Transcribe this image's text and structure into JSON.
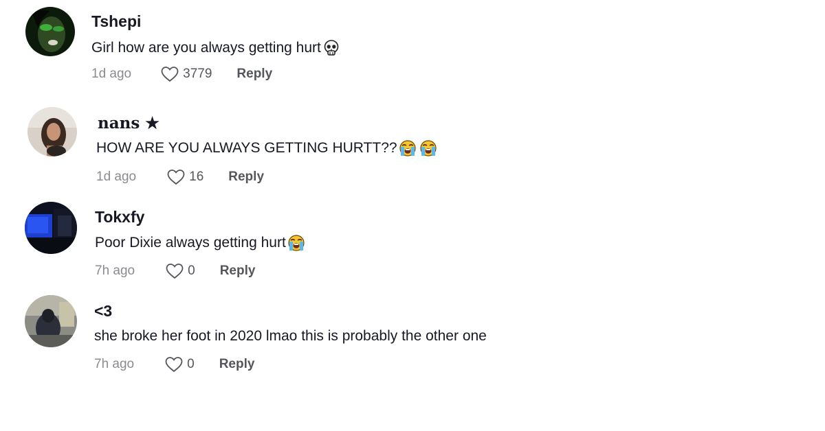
{
  "comments": [
    {
      "username": "Tshepi",
      "text": "Girl how are you always getting hurt",
      "emojis": [
        "skull-emoji"
      ],
      "time": "1d ago",
      "likes": "3779",
      "reply_label": "Reply"
    },
    {
      "username": "nans ★",
      "text": "HOW ARE YOU ALWAYS GETTING HURTT??",
      "emojis": [
        "loudly-crying-face-emoji",
        "loudly-crying-face-emoji"
      ],
      "time": "1d ago",
      "likes": "16",
      "reply_label": "Reply"
    },
    {
      "username": "Tokxfy",
      "text": "Poor Dixie always getting hurt",
      "emojis": [
        "loudly-crying-face-emoji"
      ],
      "time": "7h ago",
      "likes": "0",
      "reply_label": "Reply"
    },
    {
      "username": "<3",
      "text": "she broke her foot in 2020 lmao this is probably the other one",
      "emojis": [],
      "time": "7h ago",
      "likes": "0",
      "reply_label": "Reply"
    }
  ],
  "colors": {
    "text": "#161823",
    "muted": "#8a8b91",
    "action": "#55565c",
    "background": "#ffffff"
  }
}
